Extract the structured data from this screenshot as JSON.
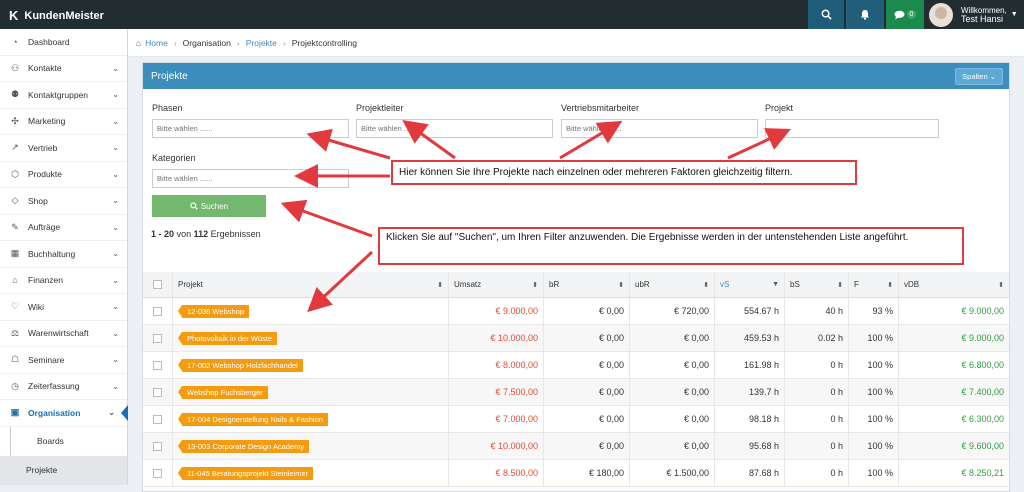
{
  "app": {
    "title": "KundenMeister"
  },
  "topbar": {
    "chat_badge": "0",
    "user_greeting": "Willkommen,",
    "user_name": "Test Hansi"
  },
  "sidebar": {
    "items": [
      {
        "label": "Dashboard",
        "icon": "dashboard-icon"
      },
      {
        "label": "Kontakte",
        "icon": "contacts-icon"
      },
      {
        "label": "Kontaktgruppen",
        "icon": "contact-groups-icon"
      },
      {
        "label": "Marketing",
        "icon": "marketing-icon"
      },
      {
        "label": "Vertrieb",
        "icon": "sales-icon"
      },
      {
        "label": "Produkte",
        "icon": "products-icon"
      },
      {
        "label": "Shop",
        "icon": "shop-icon"
      },
      {
        "label": "Aufträge",
        "icon": "orders-icon"
      },
      {
        "label": "Buchhaltung",
        "icon": "accounting-icon"
      },
      {
        "label": "Finanzen",
        "icon": "finance-icon"
      },
      {
        "label": "Wiki",
        "icon": "wiki-icon"
      },
      {
        "label": "Warenwirtschaft",
        "icon": "inventory-icon"
      },
      {
        "label": "Seminare",
        "icon": "seminars-icon"
      },
      {
        "label": "Zeiterfassung",
        "icon": "time-tracking-icon"
      },
      {
        "label": "Organisation",
        "icon": "organisation-icon"
      }
    ],
    "subitems": [
      {
        "label": "Boards"
      },
      {
        "label": "Projekte"
      }
    ]
  },
  "breadcrumb": {
    "home": "Home",
    "level1": "Organisation",
    "level2": "Projekte",
    "current": "Projektcontrolling"
  },
  "panel": {
    "title": "Projekte",
    "columns_button": "Spalten"
  },
  "filters": {
    "phasen": {
      "label": "Phasen",
      "placeholder": "Bitte wählen ......"
    },
    "projektleiter": {
      "label": "Projektleiter",
      "placeholder": "Bitte wählen ......"
    },
    "vertrieb": {
      "label": "Vertriebsmitarbeiter",
      "placeholder": "Bitte wählen ......"
    },
    "projekt": {
      "label": "Projekt",
      "placeholder": ""
    },
    "kategorien": {
      "label": "Kategorien",
      "placeholder": "Bitte wählen ......"
    },
    "search_button": "Suchen"
  },
  "results": {
    "from": "1",
    "dash": "-",
    "to": "20",
    "of": "von",
    "total": "112",
    "suffix": "Ergebnissen"
  },
  "table": {
    "headers": [
      "Projekt",
      "Umsatz",
      "bR",
      "ubR",
      "vS",
      "bS",
      "F",
      "vDB"
    ],
    "rows": [
      {
        "projekt": "12-036 Webshop",
        "umsatz": "€ 9.000,00",
        "br": "€ 0,00",
        "ubr": "€ 720,00",
        "vs": "554.67 h",
        "bs": "40 h",
        "f": "93 %",
        "vdb": "€ 9.000,00"
      },
      {
        "projekt": "Photovoltaik in der Wüste",
        "umsatz": "€ 10.000,00",
        "br": "€ 0,00",
        "ubr": "€ 0,00",
        "vs": "459.53 h",
        "bs": "0.02 h",
        "f": "100 %",
        "vdb": "€ 9.000,00"
      },
      {
        "projekt": "17-002 Webshop Holzfachhandel",
        "umsatz": "€ 8.000,00",
        "br": "€ 0,00",
        "ubr": "€ 0,00",
        "vs": "161.98 h",
        "bs": "0 h",
        "f": "100 %",
        "vdb": "€ 6.800,00"
      },
      {
        "projekt": "Webshop Fuchsberger",
        "umsatz": "€ 7.500,00",
        "br": "€ 0,00",
        "ubr": "€ 0,00",
        "vs": "139.7 h",
        "bs": "0 h",
        "f": "100 %",
        "vdb": "€ 7.400,00"
      },
      {
        "projekt": "17-004 Designerstellung Nails & Fashion",
        "umsatz": "€ 7.000,00",
        "br": "€ 0,00",
        "ubr": "€ 0,00",
        "vs": "98.18 h",
        "bs": "0 h",
        "f": "100 %",
        "vdb": "€ 6.300,00"
      },
      {
        "projekt": "13-003 Corporate Design Academy",
        "umsatz": "€ 10.000,00",
        "br": "€ 0,00",
        "ubr": "€ 0,00",
        "vs": "95.68 h",
        "bs": "0 h",
        "f": "100 %",
        "vdb": "€ 9.600,00"
      },
      {
        "projekt": "11-045 Beratungsprojekt Steinleimer",
        "umsatz": "€ 8.500,00",
        "br": "€ 180,00",
        "ubr": "€ 1.500,00",
        "vs": "87.68 h",
        "bs": "0 h",
        "f": "100 %",
        "vdb": "€ 8.250,21"
      }
    ]
  },
  "callouts": {
    "filter": "Hier können Sie Ihre Projekte nach einzelnen oder mehreren Faktoren gleichzeitig filtern.",
    "search": "Klicken Sie auf \"Suchen\", um Ihren Filter anzuwenden. Die Ergebnisse werden in der untenstehenden Liste angeführt."
  },
  "colors": {
    "accent": "#3c8dbc",
    "topbar": "#222d32",
    "tag": "#f39c12",
    "annotation": "#e0393e",
    "search_button": "#74b76f"
  }
}
